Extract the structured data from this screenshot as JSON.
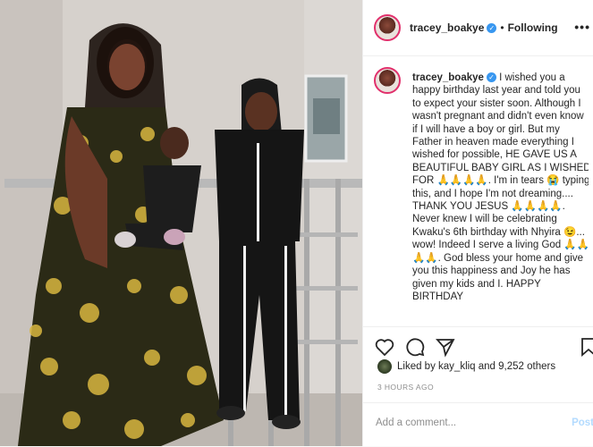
{
  "post": {
    "username": "tracey_boakye",
    "verified_mark": "✓",
    "separator": "•",
    "follow_status": "Following",
    "more_icon": "•••"
  },
  "caption": {
    "username": "tracey_boakye",
    "text": " I wished you a happy birthday last year and told you to expect your sister soon. Although I wasn't pregnant and didn't even know if I will have a boy or girl. But my Father in heaven made everything I wished for possible, HE GAVE US A BEAUTIFUL BABY GIRL AS I WISHED FOR 🙏🙏🙏🙏. I'm in tears 😭 typing this, and I hope I'm not dreaming.... THANK YOU JESUS 🙏🙏🙏🙏. Never knew I will be celebrating Kwaku's 6th birthday with Nhyira 😉... wow! Indeed I serve a living God 🙏🙏🙏🙏. God bless your home and give you this happiness and Joy he has given my kids and I. HAPPY BIRTHDAY"
  },
  "actions": {
    "icons": [
      "heart-icon",
      "comment-icon",
      "share-icon",
      "bookmark-icon"
    ]
  },
  "likes": {
    "text": "Liked by kay_kliq and 9,252 others"
  },
  "timestamp": "3 HOURS AGO",
  "comment_box": {
    "placeholder": "Add a comment...",
    "post_label": "Post"
  },
  "colors": {
    "verified": "#3897f0",
    "post_disabled": "#b3dbff",
    "border": "#efefef"
  }
}
